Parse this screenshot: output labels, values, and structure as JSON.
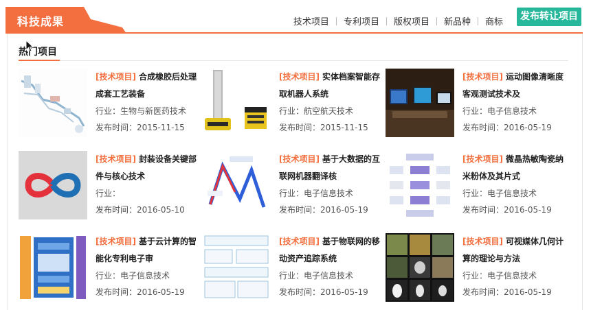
{
  "header": {
    "brand_title": "科技成果",
    "nav": [
      "技术项目",
      "专利项目",
      "版权项目",
      "新品种",
      "商标"
    ],
    "publish_label": "发布转让项目"
  },
  "section": {
    "title": "热门项目"
  },
  "labels": {
    "industry_prefix": "行业：",
    "date_prefix": "发布时间："
  },
  "colors": {
    "accent": "#f36f3f",
    "green": "#27b89c"
  },
  "projects": [
    {
      "tag": "[技术项目]",
      "title": "合成橡胶后处理成套工艺装备",
      "industry": "生物与新医药技术",
      "date": "2015-11-15",
      "thumb_icon": "process-line-diagram"
    },
    {
      "tag": "[技术项目]",
      "title": "实体档案智能存取机器人系统",
      "industry": "航空航天技术",
      "date": "2015-11-15",
      "thumb_icon": "yellow-robot-photo"
    },
    {
      "tag": "[技术项目]",
      "title": "运动图像清晰度客观测试技术及",
      "industry": "电子信息技术",
      "date": "2016-05-19",
      "thumb_icon": "lab-monitors-photo"
    },
    {
      "tag": "[技术项目]",
      "title": "封装设备关键部件与核心技术",
      "industry": "",
      "date": "2016-05-10",
      "thumb_icon": "infinity-logo"
    },
    {
      "tag": "[技术项目]",
      "title": "基于大数据的互联网机器翻译核",
      "industry": "电子信息技术",
      "date": "2016-05-19",
      "thumb_icon": "baidu-translate-logo"
    },
    {
      "tag": "[技术项目]",
      "title": "微晶热敏陶瓷纳米粉体及其片式",
      "industry": "电子信息技术",
      "date": "2016-05-19",
      "thumb_icon": "flow-chart"
    },
    {
      "tag": "[技术项目]",
      "title": "基于云计算的智能化专利电子审",
      "industry": "电子信息技术",
      "date": "2016-05-19",
      "thumb_icon": "system-architecture-diagram"
    },
    {
      "tag": "[技术项目]",
      "title": "基于物联网的移动资产追踪系统",
      "industry": "电子信息技术",
      "date": "2016-05-19",
      "thumb_icon": "block-diagram"
    },
    {
      "tag": "[技术项目]",
      "title": "可视媒体几何计算的理论与方法",
      "industry": "电子信息技术",
      "date": "2016-05-19",
      "thumb_icon": "image-grid-photo"
    }
  ]
}
